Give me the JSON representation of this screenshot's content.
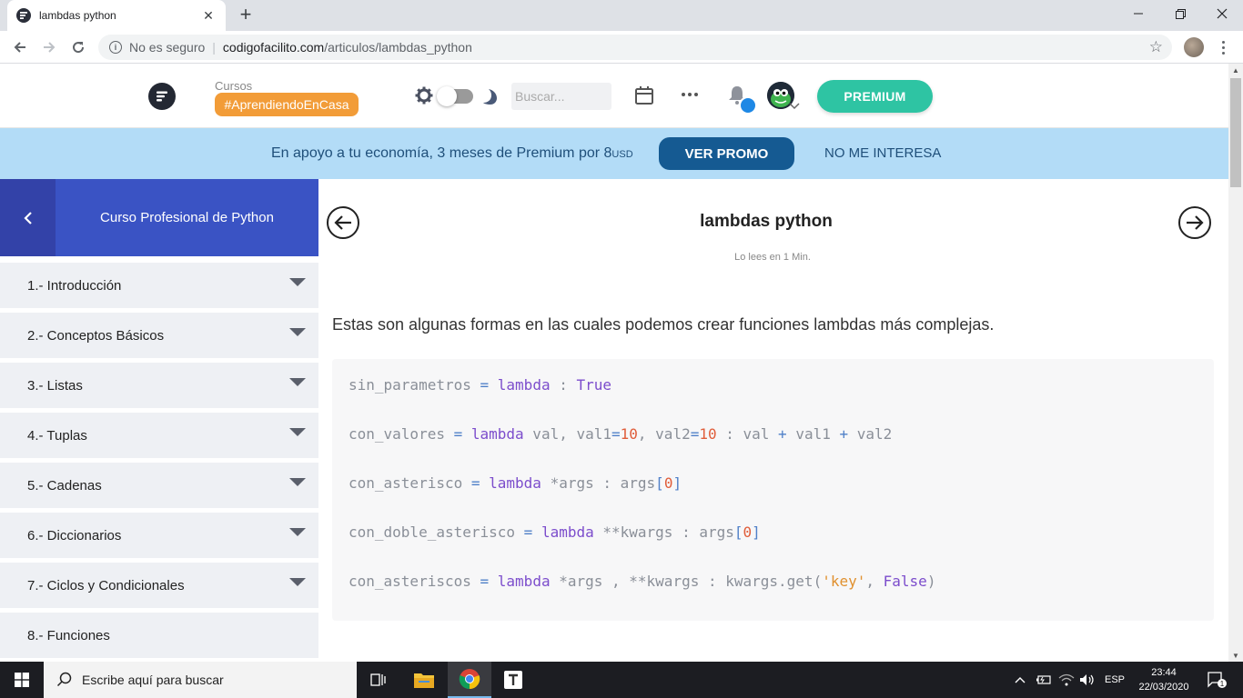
{
  "browser": {
    "tab_title": "lambdas python",
    "tab_close": "✕",
    "new_tab": "+",
    "security_label": "No es seguro",
    "url_domain": "codigofacilito.com",
    "url_path": "/articulos/lambdas_python"
  },
  "header": {
    "cursos_label": "Cursos",
    "campaign_tag": "#AprendiendoEnCasa",
    "search_placeholder": "Buscar...",
    "premium_label": "PREMIUM",
    "notification_dot_color": "#1e88e5",
    "premium_color": "#2ec4a3",
    "tag_color": "#f29c38"
  },
  "promo": {
    "text": "En apoyo a tu economía, 3 meses de Premium por 8",
    "currency": "USD",
    "cta_label": "VER PROMO",
    "dismiss_label": "NO ME INTERESA",
    "background_color": "#b3dcf7",
    "cta_color": "#155a92"
  },
  "sidebar": {
    "course_title": "Curso Profesional de Python",
    "items": [
      {
        "label": "1.- Introducción",
        "expandable": true
      },
      {
        "label": "2.- Conceptos Básicos",
        "expandable": true
      },
      {
        "label": "3.- Listas",
        "expandable": true
      },
      {
        "label": "4.- Tuplas",
        "expandable": true
      },
      {
        "label": "5.- Cadenas",
        "expandable": true
      },
      {
        "label": "6.- Diccionarios",
        "expandable": true
      },
      {
        "label": "7.- Ciclos y Condicionales",
        "expandable": true
      },
      {
        "label": "8.- Funciones",
        "expandable": false
      }
    ]
  },
  "article": {
    "title": "lambdas python",
    "read_time": "Lo lees en 1 Min.",
    "intro": "Estas son algunas formas en las cuales podemos crear funciones lambdas más complejas.",
    "code_lines": [
      "sin_parametros = lambda : True",
      "con_valores = lambda val, val1=10, val2=10 : val + val1 + val2",
      "con_asterisco = lambda *args : args[0]",
      "con_doble_asterisco = lambda **kwargs : args[0]",
      "con_asteriscos = lambda *args , **kwargs : kwargs.get('key', False)"
    ]
  },
  "taskbar": {
    "search_placeholder": "Escribe aquí para buscar",
    "language": "ESP",
    "time": "23:44",
    "date": "22/03/2020",
    "notification_count": "1",
    "apps": [
      "task-view",
      "file-explorer",
      "chrome",
      "typora"
    ]
  }
}
